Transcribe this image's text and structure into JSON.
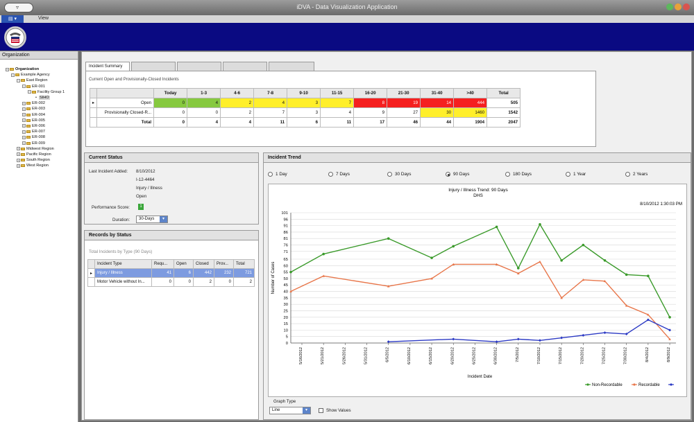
{
  "window": {
    "title": "iDVA - Data Visualization Application",
    "qat_label": "▿",
    "file_label": "▤ ▾",
    "view_label": "View"
  },
  "colors": {
    "accent": "#0a0a82",
    "green": "#86c93f",
    "yellow": "#ffef2a",
    "red": "#f52020",
    "nonrec": "#3a9a2a",
    "rec": "#e8764a",
    "third": "#2b39c4"
  },
  "org": {
    "title": "Organization",
    "tree": [
      {
        "label": "Organization",
        "level": 0,
        "bold": true
      },
      {
        "label": "Example Agency",
        "level": 1
      },
      {
        "label": "East Region",
        "level": 2
      },
      {
        "label": "ER-001",
        "level": 3
      },
      {
        "label": "Facility Group 1",
        "level": 4
      },
      {
        "label": "SIHO",
        "level": 5,
        "selected": true
      },
      {
        "label": "ER-002",
        "level": 3
      },
      {
        "label": "ER-003",
        "level": 3
      },
      {
        "label": "ER-004",
        "level": 3
      },
      {
        "label": "ER-005",
        "level": 3
      },
      {
        "label": "ER-006",
        "level": 3
      },
      {
        "label": "ER-007",
        "level": 3
      },
      {
        "label": "ER-008",
        "level": 3
      },
      {
        "label": "ER-009",
        "level": 3
      },
      {
        "label": "Midwest Region",
        "level": 2
      },
      {
        "label": "Pacific Region",
        "level": 2
      },
      {
        "label": "South Region",
        "level": 2
      },
      {
        "label": "West Region",
        "level": 2
      }
    ]
  },
  "tabs": [
    "Incident Summary",
    "",
    "",
    "",
    ""
  ],
  "summary": {
    "caption": "Current Open and Provisionally-Closed Incidents",
    "columns": [
      "",
      "Today",
      "1-3",
      "4-6",
      "7-8",
      "9-10",
      "11-15",
      "16-20",
      "21-30",
      "31-40",
      ">40",
      "Total"
    ],
    "rows": [
      {
        "label": "Open",
        "cells": [
          "0",
          "4",
          "2",
          "4",
          "3",
          "7",
          "8",
          "19",
          "14",
          "444",
          "505"
        ],
        "colors": [
          "g",
          "g",
          "y",
          "y",
          "y",
          "y",
          "r",
          "r",
          "r",
          "r",
          ""
        ]
      },
      {
        "label": "Provisionally Closed-R...",
        "cells": [
          "0",
          "0",
          "2",
          "7",
          "3",
          "4",
          "9",
          "27",
          "30",
          "1460",
          "1542"
        ],
        "colors": [
          "",
          "",
          "",
          "",
          "",
          "",
          "",
          "",
          "y",
          "y",
          ""
        ]
      },
      {
        "label": "Total",
        "cells": [
          "0",
          "4",
          "4",
          "11",
          "6",
          "11",
          "17",
          "46",
          "44",
          "1904",
          "2047"
        ],
        "colors": [
          "",
          "",
          "",
          "",
          "",
          "",
          "",
          "",
          "",
          "",
          ""
        ]
      }
    ]
  },
  "status": {
    "title": "Current Status",
    "last_label": "Last Incident Added:",
    "last_date": "8/10/2012",
    "last_id": "I-12-4464",
    "last_type": "Injury / Illness",
    "last_state": "Open",
    "perf_label": "Performance Score:",
    "perf_value": "1",
    "duration_label": "Duration:",
    "duration_value": "30-Days"
  },
  "records": {
    "title": "Records by Status",
    "caption": "Total Incidents by Type (90 Days)",
    "columns": [
      "Incident Type",
      "Requ...",
      "Open",
      "Closed",
      "Prov...",
      "Total"
    ],
    "rows": [
      [
        "Injury / Illness",
        "41",
        "6",
        "442",
        "232",
        "721"
      ],
      [
        "Motor Vehicle without In...",
        "0",
        "0",
        "2",
        "0",
        "2"
      ]
    ]
  },
  "trend": {
    "title": "Incident Trend",
    "ranges": [
      "1 Day",
      "7 Days",
      "30 Days",
      "90 Days",
      "180 Days",
      "1 Year",
      "2 Years"
    ],
    "selected_range": "90 Days",
    "graph_type_label": "Graph Type",
    "graph_type_value": "Line",
    "show_values_label": "Show Values",
    "timestamp": "8/10/2012 1:30:03 PM"
  },
  "chart_data": {
    "type": "line",
    "title": "Injury / Illness Trend: 90 Days",
    "subtitle": "DHS",
    "xlabel": "Incident Date",
    "ylabel": "Number of Cases",
    "ylim": [
      0,
      101
    ],
    "yticks": [
      0,
      5,
      10,
      15,
      20,
      25,
      30,
      35,
      40,
      45,
      50,
      55,
      60,
      65,
      71,
      76,
      81,
      86,
      91,
      96,
      101
    ],
    "x": [
      "5/16/2012",
      "5/21/2012",
      "5/26/2012",
      "5/31/2012",
      "6/5/2012",
      "6/10/2012",
      "6/15/2012",
      "6/20/2012",
      "6/25/2012",
      "6/30/2012",
      "7/5/2012",
      "7/10/2012",
      "7/15/2012",
      "7/20/2012",
      "7/25/2012",
      "7/30/2012",
      "8/4/2012",
      "8/9/2012"
    ],
    "legend_position": "bottom-right",
    "series": [
      {
        "name": "Non-Recordable",
        "color": "#3a9a2a",
        "values": [
          55,
          69,
          81,
          66,
          75,
          90,
          58,
          92,
          64,
          76,
          64,
          53,
          52,
          20
        ]
      },
      {
        "name": "Recordable",
        "color": "#e8764a",
        "values": [
          40,
          52,
          44,
          50,
          61,
          61,
          54,
          63,
          35,
          49,
          48,
          29,
          22,
          3
        ]
      },
      {
        "name": "",
        "color": "#2b39c4",
        "values": [
          1,
          3,
          1,
          3,
          2,
          4,
          6,
          8,
          7,
          18,
          10
        ]
      }
    ],
    "series_x_index": [
      [
        0,
        1,
        4,
        6,
        7,
        9,
        10,
        11,
        12,
        13,
        14,
        15,
        16,
        17
      ],
      [
        0,
        1,
        4,
        6,
        7,
        9,
        10,
        11,
        12,
        13,
        14,
        15,
        16,
        17
      ],
      [
        4,
        7,
        9,
        10,
        11,
        12,
        13,
        14,
        15,
        16,
        17
      ]
    ]
  }
}
